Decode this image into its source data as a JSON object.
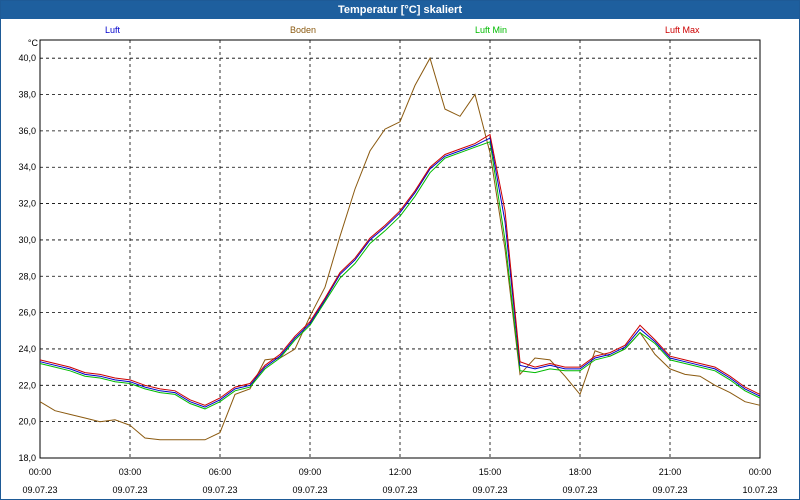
{
  "window": {
    "title": "Temperatur [°C] skaliert"
  },
  "chart_data": {
    "type": "line",
    "yunit": "°C",
    "ylim": [
      18,
      41
    ],
    "yticks": [
      "40,0",
      "38,0",
      "36,0",
      "34,0",
      "32,0",
      "30,0",
      "28,0",
      "26,0",
      "24,0",
      "22,0",
      "20,0",
      "18,0"
    ],
    "xticks": [
      {
        "time": "00:00",
        "date": "09.07.23"
      },
      {
        "time": "03:00",
        "date": "09.07.23"
      },
      {
        "time": "06:00",
        "date": "09.07.23"
      },
      {
        "time": "09:00",
        "date": "09.07.23"
      },
      {
        "time": "12:00",
        "date": "09.07.23"
      },
      {
        "time": "15:00",
        "date": "09.07.23"
      },
      {
        "time": "18:00",
        "date": "09.07.23"
      },
      {
        "time": "21:00",
        "date": "09.07.23"
      },
      {
        "time": "00:00",
        "date": "10.07.23"
      }
    ],
    "grid": true,
    "legend_placement": "top",
    "x_hours": [
      0,
      0.5,
      1,
      1.5,
      2,
      2.5,
      3,
      3.5,
      4,
      4.5,
      5,
      5.5,
      6,
      6.5,
      7,
      7.5,
      8,
      8.5,
      9,
      9.5,
      10,
      10.5,
      11,
      11.5,
      12,
      12.5,
      13,
      13.5,
      14,
      14.5,
      15,
      15.5,
      16,
      16.5,
      17,
      17.5,
      18,
      18.5,
      19,
      19.5,
      20,
      20.5,
      21,
      21.5,
      22,
      22.5,
      23,
      23.5,
      24
    ],
    "series": [
      {
        "name": "Luft",
        "color": "#0000cc",
        "values": [
          23.3,
          23.1,
          22.9,
          22.6,
          22.5,
          22.3,
          22.2,
          21.9,
          21.7,
          21.6,
          21.1,
          20.8,
          21.2,
          21.8,
          22.0,
          23.0,
          23.6,
          24.6,
          25.4,
          26.7,
          28.1,
          28.9,
          30.0,
          30.7,
          31.5,
          32.6,
          33.9,
          34.6,
          34.9,
          35.2,
          35.6,
          31.0,
          23.1,
          22.9,
          23.1,
          22.9,
          22.9,
          23.5,
          23.7,
          24.1,
          25.1,
          24.4,
          23.5,
          23.3,
          23.1,
          22.9,
          22.4,
          21.8,
          21.4
        ]
      },
      {
        "name": "Boden",
        "color": "#8b5a10",
        "values": [
          21.1,
          20.6,
          20.4,
          20.2,
          20.0,
          20.1,
          19.8,
          19.1,
          19.0,
          19.0,
          19.0,
          19.0,
          19.4,
          21.5,
          21.8,
          23.4,
          23.5,
          24.0,
          25.8,
          27.4,
          30.2,
          32.8,
          34.9,
          36.1,
          36.5,
          38.5,
          40.0,
          37.2,
          36.8,
          38.0,
          34.8,
          29.5,
          22.6,
          23.5,
          23.4,
          22.5,
          21.5,
          23.9,
          23.6,
          24.0,
          24.9,
          23.7,
          22.9,
          22.6,
          22.5,
          22.0,
          21.6,
          21.1,
          20.9
        ]
      },
      {
        "name": "Luft Min",
        "color": "#00bb00",
        "values": [
          23.2,
          23.0,
          22.8,
          22.5,
          22.4,
          22.2,
          22.1,
          21.8,
          21.6,
          21.5,
          21.0,
          20.7,
          21.1,
          21.7,
          21.9,
          22.9,
          23.5,
          24.5,
          25.3,
          26.6,
          27.9,
          28.7,
          29.8,
          30.5,
          31.3,
          32.4,
          33.7,
          34.5,
          34.8,
          35.1,
          35.4,
          30.0,
          22.8,
          22.7,
          22.9,
          22.8,
          22.8,
          23.4,
          23.6,
          24.0,
          24.9,
          24.3,
          23.4,
          23.2,
          23.0,
          22.8,
          22.3,
          21.7,
          21.3
        ]
      },
      {
        "name": "Luft Max",
        "color": "#cc0000",
        "values": [
          23.4,
          23.2,
          23.0,
          22.7,
          22.6,
          22.4,
          22.3,
          22.0,
          21.8,
          21.7,
          21.2,
          20.9,
          21.3,
          21.9,
          22.1,
          23.1,
          23.7,
          24.7,
          25.5,
          26.8,
          28.2,
          29.0,
          30.1,
          30.8,
          31.6,
          32.7,
          34.0,
          34.7,
          35.0,
          35.3,
          35.8,
          31.6,
          23.3,
          23.0,
          23.2,
          23.0,
          23.0,
          23.6,
          23.8,
          24.2,
          25.3,
          24.5,
          23.6,
          23.4,
          23.2,
          23.0,
          22.5,
          21.9,
          21.5
        ]
      }
    ]
  }
}
